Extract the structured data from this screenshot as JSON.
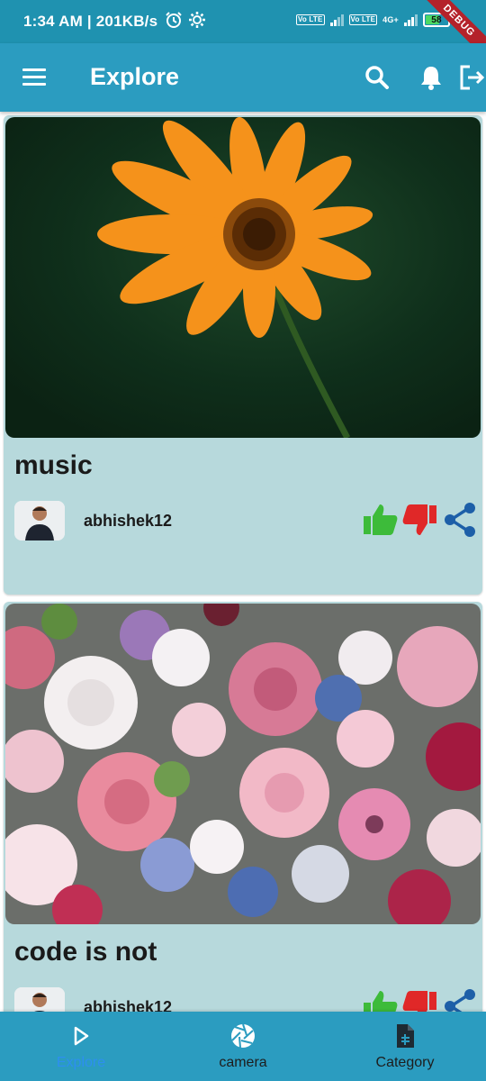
{
  "status_bar": {
    "time_speed": "1:34 AM | 201KB/s",
    "network_type": "4G+",
    "volte_label": "Vo LTE",
    "battery": "58",
    "debug_banner": "DEBUG",
    "icons": [
      "alarm-icon",
      "settings-icon"
    ]
  },
  "app_bar": {
    "title": "Explore",
    "icons": [
      "menu-icon",
      "search-icon",
      "bell-icon",
      "logout-icon"
    ]
  },
  "posts": [
    {
      "title": "music",
      "username": "abhishek12",
      "image": "orange-flower-photo",
      "actions": [
        "like-icon",
        "dislike-icon",
        "share-icon"
      ]
    },
    {
      "title": "code is not",
      "username": "abhishek12",
      "image": "flower-bouquet-photo",
      "actions": [
        "like-icon",
        "dislike-icon",
        "share-icon"
      ]
    }
  ],
  "bottom_nav": {
    "items": [
      {
        "label": "Explore",
        "icon": "play-icon",
        "active": true
      },
      {
        "label": "camera",
        "icon": "camera-aperture-icon",
        "active": false
      },
      {
        "label": "Category",
        "icon": "document-icon",
        "active": false
      }
    ]
  },
  "colors": {
    "app_bar": "#2b9cc0",
    "status_bar": "#1f92b0",
    "card_background": "#b7d9dc",
    "like": "#3dbb3a",
    "dislike": "#e02828",
    "share": "#1d5fa8",
    "active_nav": "#2d8ff0"
  }
}
